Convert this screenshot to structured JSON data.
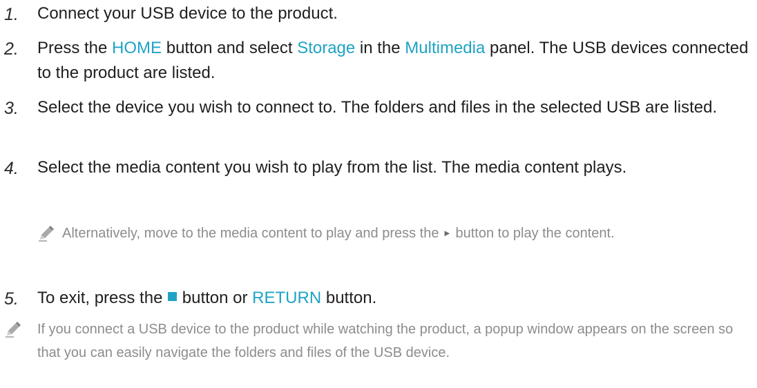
{
  "steps": [
    {
      "num": "1.",
      "text": "Connect your USB device to the product."
    },
    {
      "num": "2.",
      "pre": "Press the ",
      "hl1": "HOME",
      "mid1": " button and select ",
      "hl2": "Storage",
      "mid2": " in the ",
      "hl3": "Multimedia",
      "post": " panel. The USB devices connected to the product are listed."
    },
    {
      "num": "3.",
      "text": "Select the device you wish to connect to. The folders and files in the selected USB are listed."
    },
    {
      "num": "4.",
      "text": "Select the media content you wish to play from the list. The media content plays."
    },
    {
      "num": "5.",
      "pre": "To exit, press the ",
      "mid": " button or ",
      "hl": "RETURN",
      "post": " button."
    }
  ],
  "note_step4": {
    "pre": "Alternatively, move to the media content to play and press the ",
    "glyph": "►",
    "post": " button to play the content."
  },
  "note_final": {
    "text": "If you connect a USB device to the product while watching the product, a popup window appears on the screen so that you can easily navigate the folders and files of the USB device."
  },
  "colors": {
    "highlight": "#1fa3c4",
    "note_text": "#8c8c8c",
    "body_text": "#1f1f1f"
  },
  "icons": {
    "note": "pencil-icon",
    "stop": "stop-icon",
    "play": "play-icon"
  }
}
